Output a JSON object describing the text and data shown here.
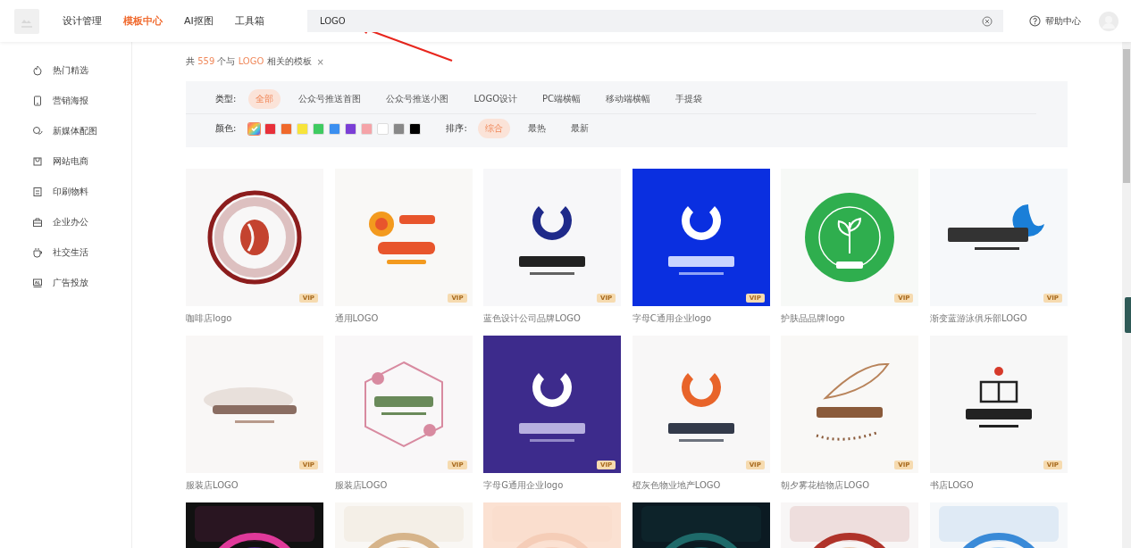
{
  "header": {
    "nav": [
      {
        "label": "设计管理",
        "selected": false
      },
      {
        "label": "模板中心",
        "selected": true
      },
      {
        "label": "AI抠图",
        "selected": false
      },
      {
        "label": "工具箱",
        "selected": false
      }
    ],
    "search": {
      "value": "LOGO"
    },
    "help": "帮助中心"
  },
  "sidebar": {
    "items": [
      {
        "label": "热门精选"
      },
      {
        "label": "营销海报"
      },
      {
        "label": "新媒体配图"
      },
      {
        "label": "网站电商"
      },
      {
        "label": "印刷物料"
      },
      {
        "label": "企业办公"
      },
      {
        "label": "社交生活"
      },
      {
        "label": "广告投放"
      }
    ]
  },
  "result": {
    "prefix": "共",
    "count": "559",
    "middle": "个与",
    "keyword": "LOGO",
    "suffix": "相关的模板",
    "clear": "×"
  },
  "filters": {
    "type_label": "类型:",
    "types": [
      {
        "label": "全部",
        "selected": true
      },
      {
        "label": "公众号推送首图",
        "selected": false
      },
      {
        "label": "公众号推送小图",
        "selected": false
      },
      {
        "label": "LOGO设计",
        "selected": false
      },
      {
        "label": "PC端横幅",
        "selected": false
      },
      {
        "label": "移动端横幅",
        "selected": false
      },
      {
        "label": "手提袋",
        "selected": false
      }
    ],
    "color_label": "颜色:",
    "colors": [
      {
        "kind": "rainbow",
        "selected": true
      },
      {
        "kind": "solid",
        "color": "#e8303a",
        "selected": false
      },
      {
        "kind": "solid",
        "color": "#f0692b",
        "selected": false
      },
      {
        "kind": "solid",
        "color": "#f7e43a",
        "selected": false
      },
      {
        "kind": "solid",
        "color": "#3fcb61",
        "selected": false
      },
      {
        "kind": "solid",
        "color": "#3b8ff0",
        "selected": false
      },
      {
        "kind": "solid",
        "color": "#7b3fd6",
        "selected": false
      },
      {
        "kind": "solid",
        "color": "#f5a3a8",
        "selected": false
      },
      {
        "kind": "solid",
        "color": "#ffffff",
        "selected": false
      },
      {
        "kind": "solid",
        "color": "#888888",
        "selected": false
      },
      {
        "kind": "solid",
        "color": "#000000",
        "selected": false
      }
    ],
    "sort_label": "排序:",
    "sorts": [
      {
        "label": "综合",
        "selected": true
      },
      {
        "label": "最热",
        "selected": false
      },
      {
        "label": "最新",
        "selected": false
      }
    ]
  },
  "templates": [
    {
      "kind": "picture",
      "badge": "VIP",
      "caption": "咖啡店logo"
    },
    {
      "kind": "picture",
      "badge": "VIP",
      "caption": "通用LOGO"
    },
    {
      "kind": "picture",
      "badge": "VIP",
      "caption": "蓝色设计公司品牌LOGO"
    },
    {
      "kind": "picture",
      "badge": "VIP",
      "caption": "字母C通用企业logo"
    },
    {
      "kind": "picture",
      "badge": "VIP",
      "caption": "护肤品品牌logo"
    },
    {
      "kind": "picture",
      "badge": "VIP",
      "caption": "渐变蓝游泳俱乐部LOGO"
    },
    {
      "kind": "picture",
      "badge": "VIP",
      "caption": "服装店LOGO"
    },
    {
      "kind": "picture",
      "badge": "VIP",
      "caption": "服装店LOGO"
    },
    {
      "kind": "picture",
      "badge": "VIP",
      "caption": "字母G通用企业logo"
    },
    {
      "kind": "picture",
      "badge": "VIP",
      "caption": "橙灰色物业地产LOGO"
    },
    {
      "kind": "picture",
      "badge": "VIP",
      "caption": "朝夕雾花植物店LOGO"
    },
    {
      "kind": "picture",
      "badge": "VIP",
      "caption": "书店LOGO"
    },
    {
      "kind": "picture"
    },
    {
      "kind": "picture"
    },
    {
      "kind": "picture"
    },
    {
      "kind": "picture"
    },
    {
      "kind": "picture"
    },
    {
      "kind": "picture"
    }
  ]
}
